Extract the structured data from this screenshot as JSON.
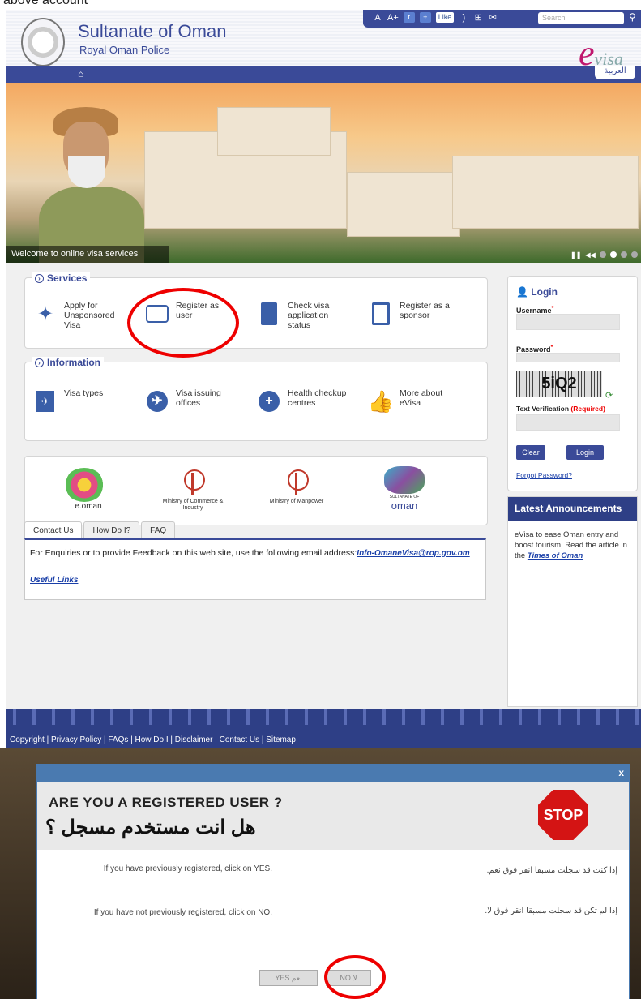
{
  "top_caption": "above account",
  "header": {
    "title": "Sultanate of Oman",
    "subtitle": "Royal Oman Police",
    "tools": [
      "A",
      "A+",
      "Like"
    ],
    "search_placeholder": "Search",
    "arabic_link": "العربية",
    "logo_e": "e",
    "logo_visa": "visa"
  },
  "banner": {
    "caption": "Welcome to online visa services"
  },
  "services": {
    "heading": "Services",
    "items": [
      {
        "label": "Apply for Unsponsored Visa",
        "icon": "magic-wand-icon"
      },
      {
        "label": "Register as user",
        "icon": "scroll-icon"
      },
      {
        "label": "Check visa application status",
        "icon": "document-icon"
      },
      {
        "label": "Register as a sponsor",
        "icon": "clipboard-icon"
      }
    ]
  },
  "information": {
    "heading": "Information",
    "items": [
      {
        "label": "Visa types",
        "icon": "passport-icon"
      },
      {
        "label": "Visa issuing offices",
        "icon": "airplane-icon"
      },
      {
        "label": "Health checkup centres",
        "icon": "plus-icon"
      },
      {
        "label": "More about eVisa",
        "icon": "thumbs-up-icon"
      }
    ]
  },
  "partners": [
    {
      "label": "e.oman"
    },
    {
      "label": "Ministry of Commerce & Industry"
    },
    {
      "label": "Ministry of Manpower"
    },
    {
      "label_top": "SULTANATE OF",
      "label": "oman"
    }
  ],
  "tabs": [
    "Contact Us",
    "How Do I?",
    "FAQ"
  ],
  "contact": {
    "text": "For Enquiries or to provide Feedback on this web site, use the following email address:",
    "email": "Info-OmaneVisa@rop.gov.om",
    "useful_links": "Useful Links"
  },
  "login": {
    "title": "Login",
    "username_label": "Username",
    "password_label": "Password",
    "captcha_text": "5iQ2",
    "text_verification": "Text Verification",
    "required": "(Required)",
    "clear": "Clear",
    "login_btn": "Login",
    "forgot": "Forgot Password?"
  },
  "announcements": {
    "title": "Latest Announcements",
    "text": "eVisa to ease Oman entry and boost tourism, Read the article in the",
    "link": "Times of Oman"
  },
  "footer": {
    "links": "Copyright  |  Privacy Policy  |  FAQs  |  How Do I  |  Disclaimer  |  Contact Us  |  Sitemap"
  },
  "modal": {
    "close": "x",
    "title": "ARE YOU A REGISTERED USER ?",
    "title_arabic": "هل انت مستخدم مسجل ؟",
    "stop": "STOP",
    "en_line1": "If you have previously registered, click on YES.",
    "en_line2": "If you have not previously registered, click on NO.",
    "ar_line1": "إذا كنت قد سجلت مسبقا انقر فوق نعم.",
    "ar_line2": "إذا لم تكن قد سجلت مسبقا انقر فوق لا.",
    "yes_btn": "YES نعم",
    "no_btn": "NO لا"
  },
  "colors": {
    "brand": "#3a4a98",
    "highlight": "#e00000",
    "stop": "#d41414"
  }
}
